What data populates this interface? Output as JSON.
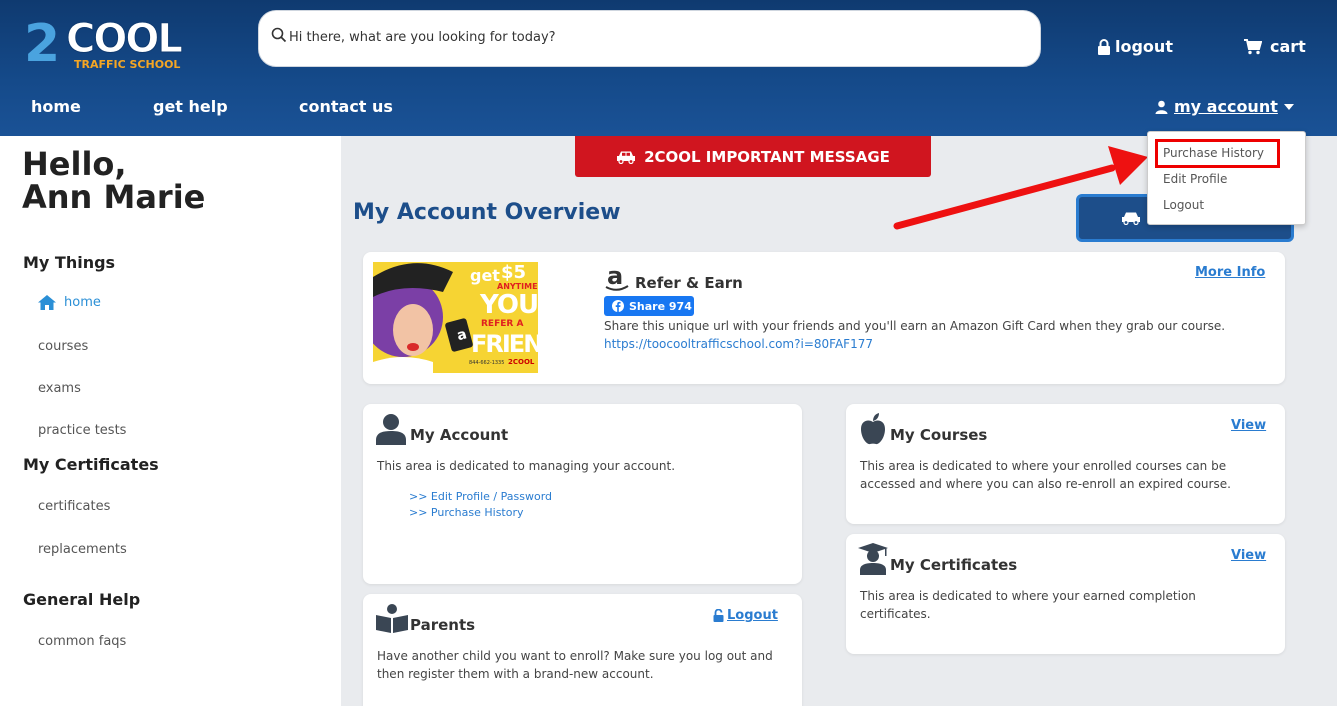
{
  "header": {
    "logo_big": "2",
    "logo_cool": "COOL",
    "logo_sub": "TRAFFIC SCHOOL",
    "search_placeholder": "Hi there, what are you looking for today?",
    "logout_label": "logout",
    "cart_label": "cart",
    "nav": [
      "home",
      "get help",
      "contact us"
    ],
    "account_label": "my account"
  },
  "dropdown": {
    "items": [
      "Purchase History",
      "Edit Profile",
      "Logout"
    ],
    "highlighted_item": "Purchase History"
  },
  "sidebar": {
    "greeting_line1": "Hello,",
    "greeting_line2": "Ann Marie",
    "sections": [
      {
        "heading": "My Things",
        "items": [
          "home",
          "courses",
          "exams",
          "practice tests"
        ]
      },
      {
        "heading": "My Certificates",
        "items": [
          "certificates",
          "replacements"
        ]
      },
      {
        "heading": "General Help",
        "items": [
          "common faqs"
        ]
      }
    ],
    "active_item": "home"
  },
  "main": {
    "important_button": "2COOL IMPORTANT MESSAGE",
    "overview_title": "My Account Overview",
    "refer": {
      "title": "Refer & Earn",
      "more_info": "More Info",
      "share_label": "Share 974",
      "text": "Share this unique url with your friends and you'll earn an Amazon Gift Card when they grab our course.",
      "url": "https://toocooltrafficschool.com?i=80FAF177",
      "img_get": "get",
      "img_amount": "$5",
      "img_anytime": "ANYTIME",
      "img_you": "YOU",
      "img_refer": "REFER A",
      "img_friend": "FRIEND",
      "img_phone": "844-662-1335",
      "img_brand": "2COOL"
    },
    "my_account": {
      "title": "My Account",
      "text": "This area is dedicated to managing your account.",
      "links": [
        ">> Edit Profile / Password",
        ">> Purchase History"
      ]
    },
    "my_courses": {
      "title": "My Courses",
      "view": "View",
      "text": "This area is dedicated to where your enrolled courses can be accessed and where you can also re-enroll an expired course."
    },
    "my_certificates": {
      "title": "My Certificates",
      "view": "View",
      "text": "This area is dedicated to where your earned completion certificates."
    },
    "parents": {
      "title": "Parents",
      "logout": "Logout",
      "text": "Have another child you want to enroll? Make sure you log out and then register them with a brand-new account."
    }
  },
  "colors": {
    "header_bg": "#154a8a",
    "accent_blue": "#2a7cd0",
    "important_red": "#d0151f",
    "highlight_red": "#ee0000"
  }
}
